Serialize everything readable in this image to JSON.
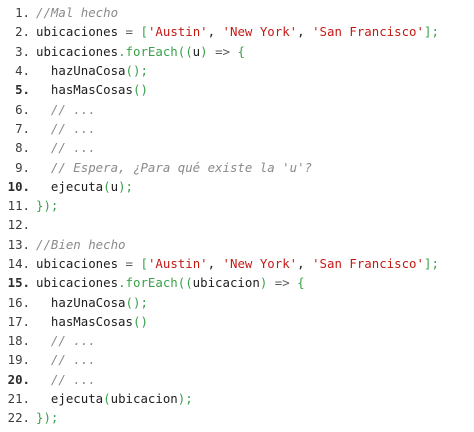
{
  "code": {
    "language": "javascript",
    "lines": [
      {
        "number": "1.",
        "bold": false,
        "tokens": [
          {
            "t": "//Mal hecho",
            "k": "comment"
          }
        ]
      },
      {
        "number": "2.",
        "bold": false,
        "tokens": [
          {
            "t": "ubicaciones ",
            "k": "plain"
          },
          {
            "t": "=",
            "k": "op"
          },
          {
            "t": " ",
            "k": "plain"
          },
          {
            "t": "[",
            "k": "punc"
          },
          {
            "t": "'Austin'",
            "k": "string"
          },
          {
            "t": ", ",
            "k": "plain"
          },
          {
            "t": "'New York'",
            "k": "string"
          },
          {
            "t": ", ",
            "k": "plain"
          },
          {
            "t": "'San Francisco'",
            "k": "string"
          },
          {
            "t": "];",
            "k": "punc"
          }
        ]
      },
      {
        "number": "3.",
        "bold": false,
        "tokens": [
          {
            "t": "ubicaciones",
            "k": "plain"
          },
          {
            "t": ".",
            "k": "punc"
          },
          {
            "t": "forEach",
            "k": "func"
          },
          {
            "t": "((",
            "k": "punc"
          },
          {
            "t": "u",
            "k": "plain"
          },
          {
            "t": ")",
            "k": "punc"
          },
          {
            "t": " ",
            "k": "plain"
          },
          {
            "t": "=>",
            "k": "op"
          },
          {
            "t": " ",
            "k": "plain"
          },
          {
            "t": "{",
            "k": "punc"
          }
        ]
      },
      {
        "number": "4.",
        "bold": false,
        "tokens": [
          {
            "t": "  hazUnaCosa",
            "k": "plain"
          },
          {
            "t": "();",
            "k": "punc"
          }
        ]
      },
      {
        "number": "5.",
        "bold": true,
        "tokens": [
          {
            "t": "  hasMasCosas",
            "k": "plain"
          },
          {
            "t": "()",
            "k": "punc"
          }
        ]
      },
      {
        "number": "6.",
        "bold": false,
        "tokens": [
          {
            "t": "  ",
            "k": "plain"
          },
          {
            "t": "// ...",
            "k": "comment"
          }
        ]
      },
      {
        "number": "7.",
        "bold": false,
        "tokens": [
          {
            "t": "  ",
            "k": "plain"
          },
          {
            "t": "// ...",
            "k": "comment"
          }
        ]
      },
      {
        "number": "8.",
        "bold": false,
        "tokens": [
          {
            "t": "  ",
            "k": "plain"
          },
          {
            "t": "// ...",
            "k": "comment"
          }
        ]
      },
      {
        "number": "9.",
        "bold": false,
        "tokens": [
          {
            "t": "  ",
            "k": "plain"
          },
          {
            "t": "// Espera, ¿Para qué existe la 'u'?",
            "k": "comment"
          }
        ]
      },
      {
        "number": "10.",
        "bold": true,
        "tokens": [
          {
            "t": "  ejecuta",
            "k": "plain"
          },
          {
            "t": "(",
            "k": "punc"
          },
          {
            "t": "u",
            "k": "plain"
          },
          {
            "t": ");",
            "k": "punc"
          }
        ]
      },
      {
        "number": "11.",
        "bold": false,
        "tokens": [
          {
            "t": "});",
            "k": "punc"
          }
        ]
      },
      {
        "number": "12.",
        "bold": false,
        "tokens": []
      },
      {
        "number": "13.",
        "bold": false,
        "tokens": [
          {
            "t": "//Bien hecho",
            "k": "comment"
          }
        ]
      },
      {
        "number": "14.",
        "bold": false,
        "tokens": [
          {
            "t": "ubicaciones ",
            "k": "plain"
          },
          {
            "t": "=",
            "k": "op"
          },
          {
            "t": " ",
            "k": "plain"
          },
          {
            "t": "[",
            "k": "punc"
          },
          {
            "t": "'Austin'",
            "k": "string"
          },
          {
            "t": ", ",
            "k": "plain"
          },
          {
            "t": "'New York'",
            "k": "string"
          },
          {
            "t": ", ",
            "k": "plain"
          },
          {
            "t": "'San Francisco'",
            "k": "string"
          },
          {
            "t": "];",
            "k": "punc"
          }
        ]
      },
      {
        "number": "15.",
        "bold": true,
        "tokens": [
          {
            "t": "ubicaciones",
            "k": "plain"
          },
          {
            "t": ".",
            "k": "punc"
          },
          {
            "t": "forEach",
            "k": "func"
          },
          {
            "t": "((",
            "k": "punc"
          },
          {
            "t": "ubicacion",
            "k": "plain"
          },
          {
            "t": ")",
            "k": "punc"
          },
          {
            "t": " ",
            "k": "plain"
          },
          {
            "t": "=>",
            "k": "op"
          },
          {
            "t": " ",
            "k": "plain"
          },
          {
            "t": "{",
            "k": "punc"
          }
        ]
      },
      {
        "number": "16.",
        "bold": false,
        "tokens": [
          {
            "t": "  hazUnaCosa",
            "k": "plain"
          },
          {
            "t": "();",
            "k": "punc"
          }
        ]
      },
      {
        "number": "17.",
        "bold": false,
        "tokens": [
          {
            "t": "  hasMasCosas",
            "k": "plain"
          },
          {
            "t": "()",
            "k": "punc"
          }
        ]
      },
      {
        "number": "18.",
        "bold": false,
        "tokens": [
          {
            "t": "  ",
            "k": "plain"
          },
          {
            "t": "// ...",
            "k": "comment"
          }
        ]
      },
      {
        "number": "19.",
        "bold": false,
        "tokens": [
          {
            "t": "  ",
            "k": "plain"
          },
          {
            "t": "// ...",
            "k": "comment"
          }
        ]
      },
      {
        "number": "20.",
        "bold": true,
        "tokens": [
          {
            "t": "  ",
            "k": "plain"
          },
          {
            "t": "// ...",
            "k": "comment"
          }
        ]
      },
      {
        "number": "21.",
        "bold": false,
        "tokens": [
          {
            "t": "  ejecuta",
            "k": "plain"
          },
          {
            "t": "(",
            "k": "punc"
          },
          {
            "t": "ubicacion",
            "k": "plain"
          },
          {
            "t": ");",
            "k": "punc"
          }
        ]
      },
      {
        "number": "22.",
        "bold": false,
        "tokens": [
          {
            "t": "});",
            "k": "punc"
          }
        ]
      }
    ]
  },
  "colors": {
    "background": "#ffffff",
    "comment": "#8a8a8a",
    "string": "#c41a16",
    "function": "#3aa14a",
    "punctuation": "#3aa14a",
    "text": "#1e1e1e",
    "line_number": "#3c3c3c"
  }
}
